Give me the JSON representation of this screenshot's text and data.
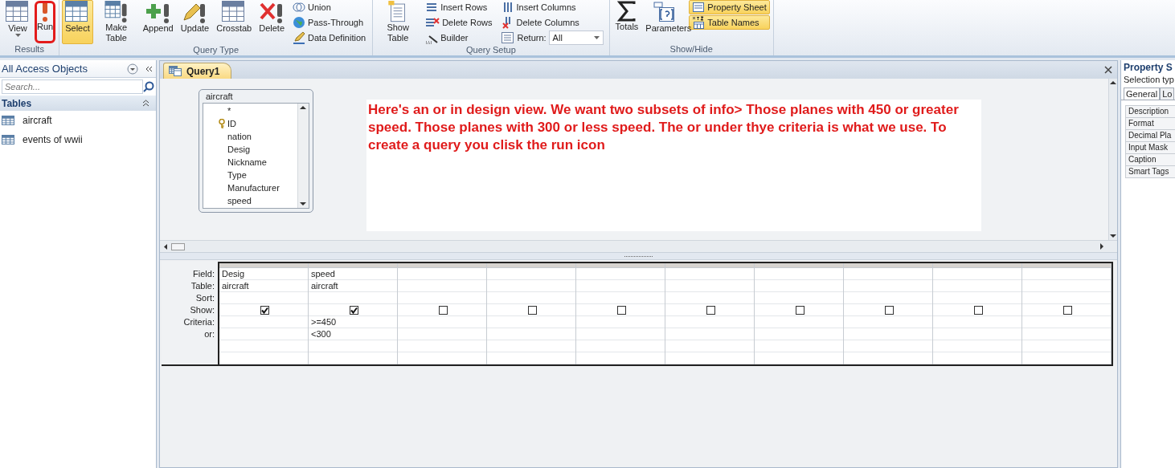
{
  "ribbon": {
    "groups": [
      {
        "label": "Results",
        "items": [
          {
            "kind": "large",
            "label": "View",
            "dropdown": true,
            "selected": false
          },
          {
            "kind": "large",
            "label": "Run",
            "selected": false,
            "circled": true
          }
        ]
      },
      {
        "label": "Query Type",
        "items": [
          {
            "kind": "large",
            "label": "Select",
            "selected": true
          },
          {
            "kind": "large",
            "label": "Make Table",
            "selected": false
          },
          {
            "kind": "large",
            "label": "Append",
            "selected": false
          },
          {
            "kind": "large",
            "label": "Update",
            "selected": false
          },
          {
            "kind": "large",
            "label": "Crosstab",
            "selected": false
          },
          {
            "kind": "large",
            "label": "Delete",
            "selected": false
          },
          {
            "kind": "stack",
            "items": [
              {
                "kind": "small",
                "label": "Union",
                "selected": false
              },
              {
                "kind": "small",
                "label": "Pass-Through",
                "selected": false
              },
              {
                "kind": "small",
                "label": "Data Definition",
                "selected": false
              }
            ]
          }
        ]
      },
      {
        "label": "Query Setup",
        "items": [
          {
            "kind": "large",
            "label": "Show Table",
            "selected": false
          },
          {
            "kind": "stack",
            "items": [
              {
                "kind": "small",
                "label": "Insert Rows",
                "selected": false
              },
              {
                "kind": "small",
                "label": "Delete Rows",
                "selected": false
              },
              {
                "kind": "small",
                "label": "Builder",
                "selected": false
              }
            ]
          },
          {
            "kind": "stack",
            "items": [
              {
                "kind": "small",
                "label": "Insert Columns",
                "selected": false
              },
              {
                "kind": "small",
                "label": "Delete Columns",
                "selected": false
              },
              {
                "kind": "dropdown",
                "label": "Return:",
                "value": "All"
              }
            ]
          }
        ]
      },
      {
        "label": "Show/Hide",
        "items": [
          {
            "kind": "large",
            "label": "Totals",
            "selected": false
          },
          {
            "kind": "large",
            "label": "Parameters",
            "selected": false
          },
          {
            "kind": "stack",
            "items": [
              {
                "kind": "small",
                "label": "Property Sheet",
                "selected": true
              },
              {
                "kind": "small",
                "label": "Table Names",
                "selected": true
              }
            ]
          }
        ]
      }
    ]
  },
  "nav_pane": {
    "title": "All Access Objects",
    "search": {
      "placeholder": "Search..."
    },
    "group": {
      "label": "Tables",
      "expanded": true
    },
    "items": [
      {
        "label": "aircraft",
        "selected": false
      },
      {
        "label": "events of wwii",
        "selected": false
      }
    ]
  },
  "document_tabs": [
    {
      "label": "Query1",
      "selected": true
    }
  ],
  "field_list": {
    "title": "aircraft",
    "fields": [
      {
        "name": "*",
        "primary_key": false
      },
      {
        "name": "ID",
        "primary_key": true
      },
      {
        "name": "nation",
        "primary_key": false
      },
      {
        "name": "Desig",
        "primary_key": false
      },
      {
        "name": "Nickname",
        "primary_key": false
      },
      {
        "name": "Type",
        "primary_key": false
      },
      {
        "name": "Manufacturer",
        "primary_key": false
      },
      {
        "name": "speed",
        "primary_key": false
      }
    ]
  },
  "annotation": {
    "text": "Here's an or in design view. We want two subsets of info> Those planes with 450 or greater speed. Those planes with 300 or less speed. The or under thye criteria is what we use. To create a query you clisk the run icon"
  },
  "grid": {
    "row_labels": [
      "Field:",
      "Table:",
      "Sort:",
      "Show:",
      "Criteria:",
      "or:"
    ],
    "columns": [
      {
        "field": "Desig",
        "table": "aircraft",
        "show": true
      },
      {
        "field": "speed",
        "table": "aircraft",
        "show": true,
        "criteria": ">=450",
        "or": "<300"
      },
      {
        "show": false
      },
      {
        "show": false
      },
      {
        "show": false
      },
      {
        "show": false
      },
      {
        "show": false
      },
      {
        "show": false
      },
      {
        "show": false
      },
      {
        "show": false
      }
    ]
  },
  "property_sheet": {
    "title": "Property S",
    "subtitle": "Selection typ",
    "tabs": [
      {
        "label": "General",
        "selected": true
      },
      {
        "label": "Lo",
        "selected": false
      }
    ],
    "properties": [
      "Description",
      "Format",
      "Decimal Pla",
      "Input Mask",
      "Caption",
      "Smart Tags"
    ]
  }
}
